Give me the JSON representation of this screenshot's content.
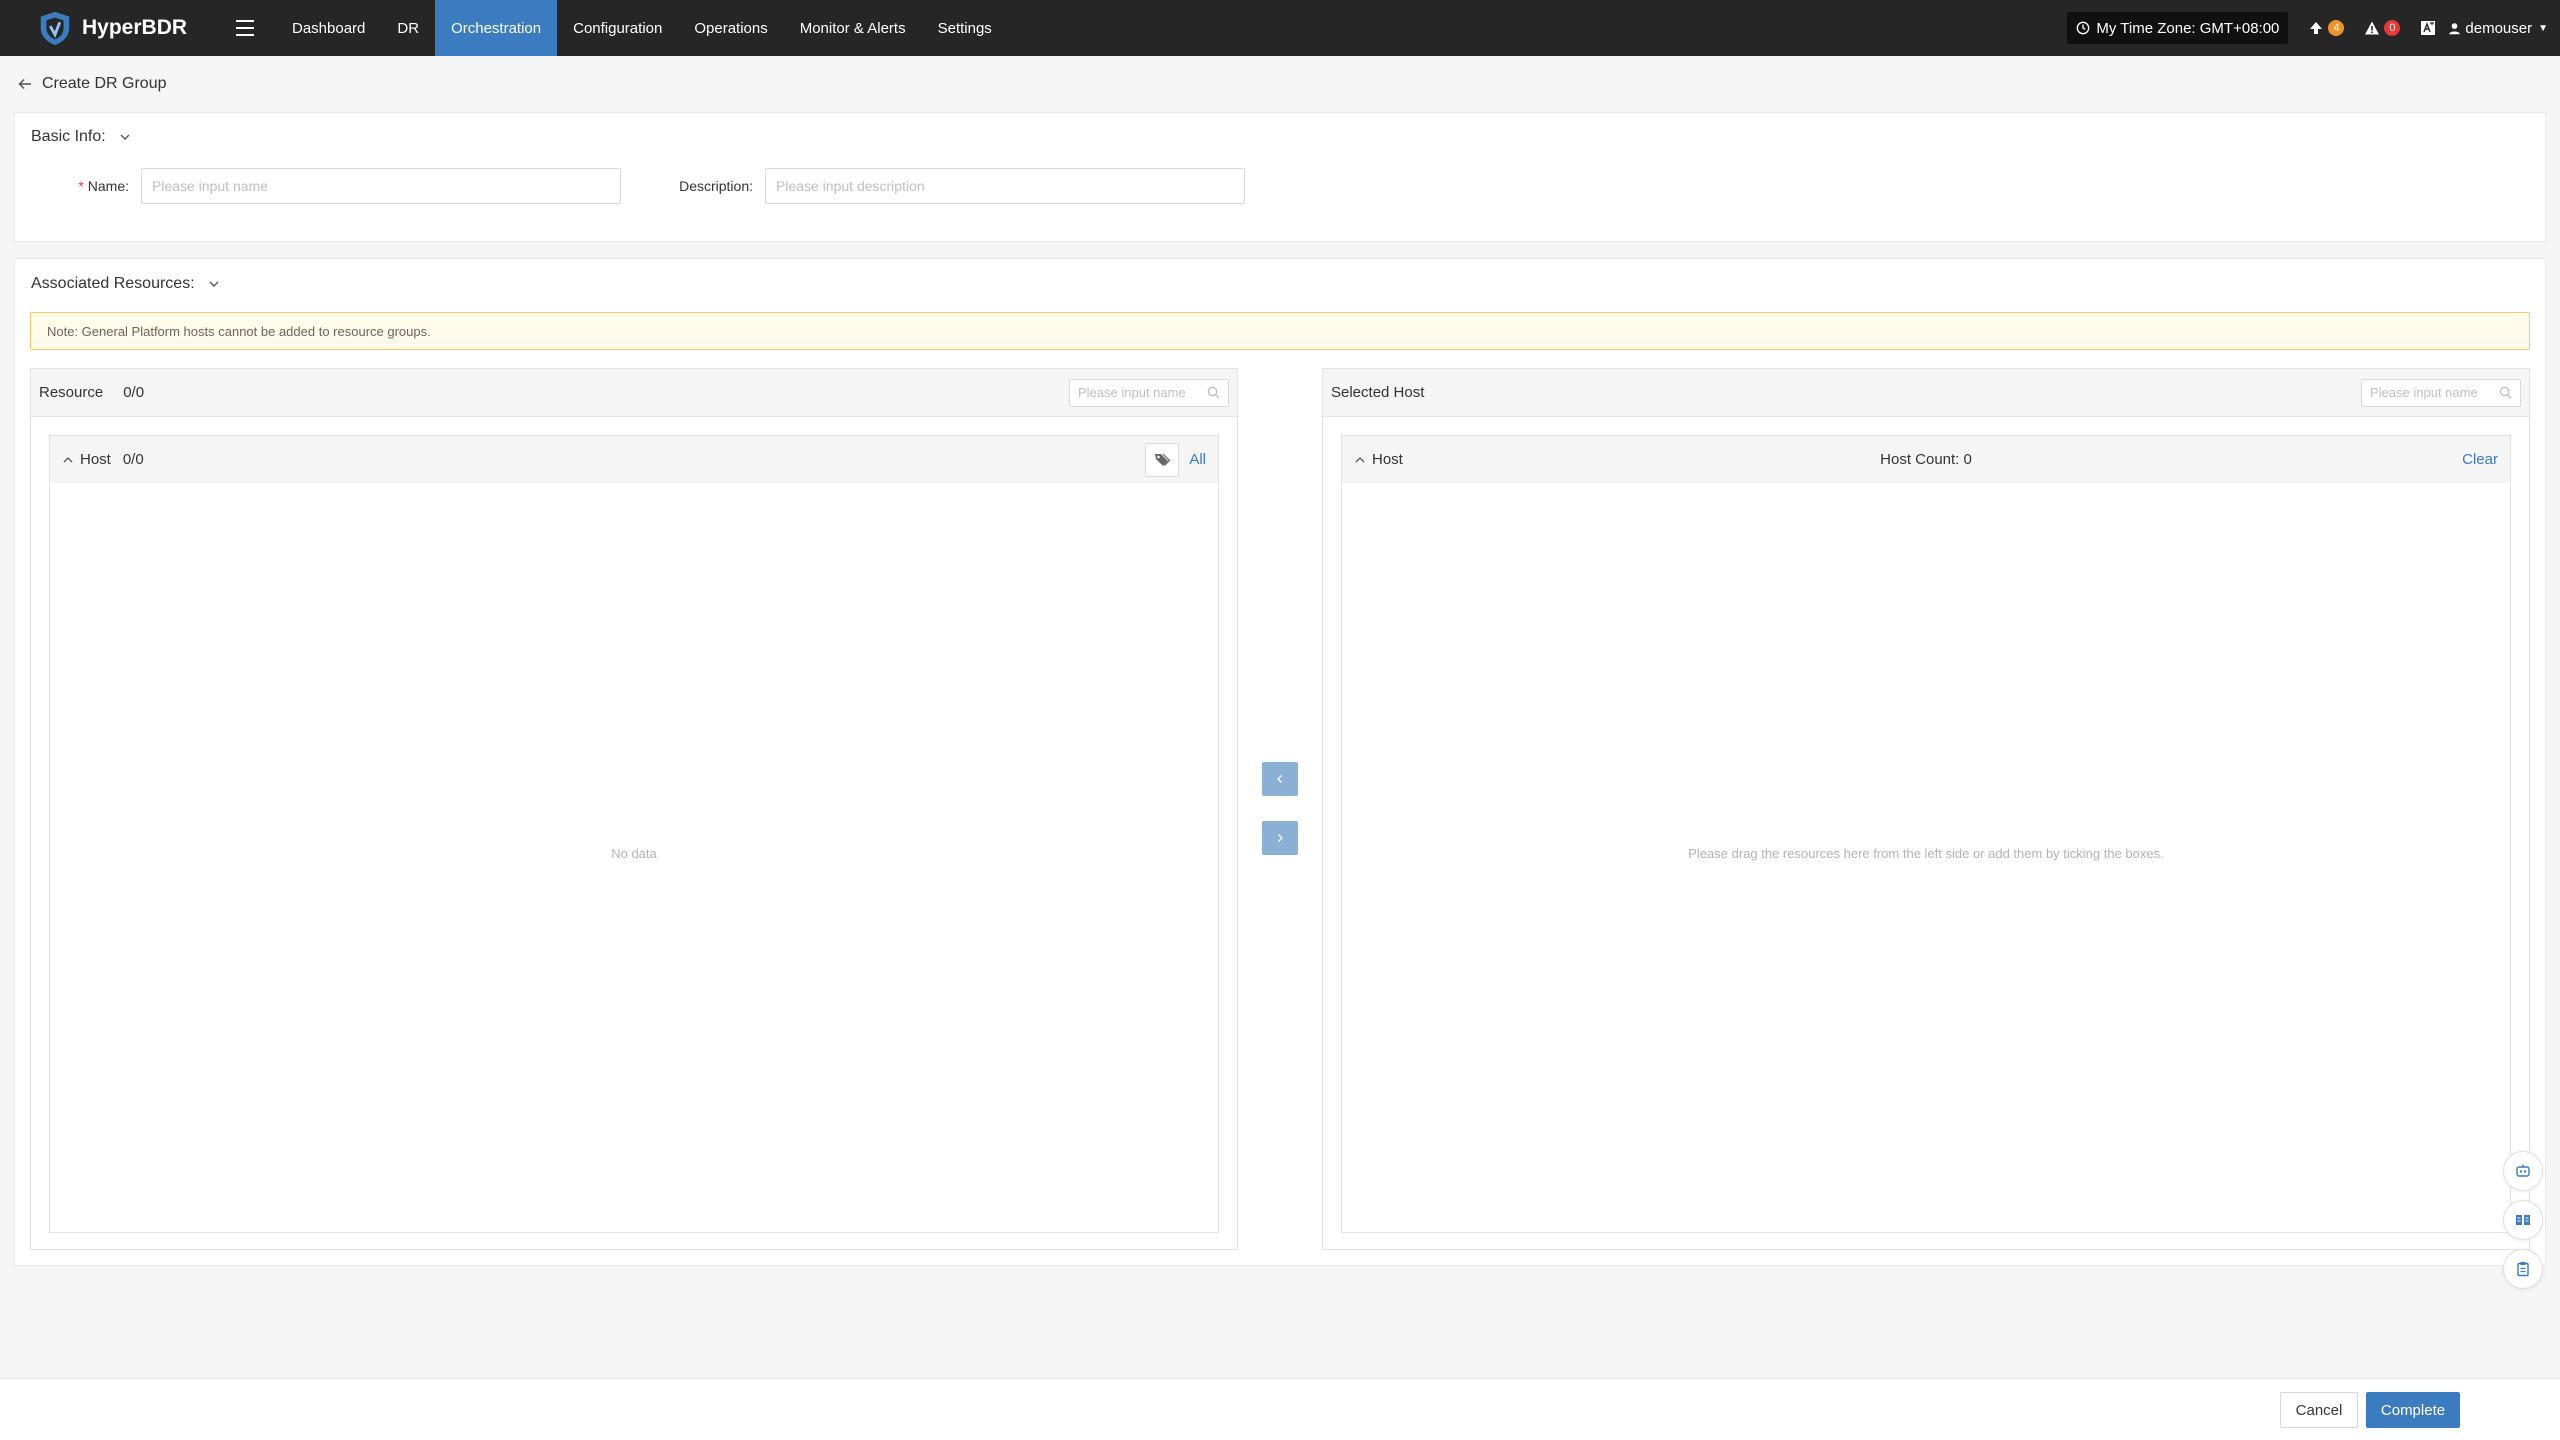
{
  "app": {
    "name": "HyperBDR"
  },
  "nav": {
    "items": [
      {
        "label": "Dashboard"
      },
      {
        "label": "DR"
      },
      {
        "label": "Orchestration"
      },
      {
        "label": "Configuration"
      },
      {
        "label": "Operations"
      },
      {
        "label": "Monitor & Alerts"
      },
      {
        "label": "Settings"
      }
    ],
    "active": "Orchestration"
  },
  "header_right": {
    "timezone": "My Time Zone: GMT+08:00",
    "upgrade_count": "4",
    "alert_count": "0",
    "username": "demouser"
  },
  "page": {
    "title": "Create DR Group"
  },
  "basic_info": {
    "title": "Basic Info:",
    "name_label": "Name:",
    "name_placeholder": "Please input name",
    "description_label": "Description:",
    "description_placeholder": "Please input description"
  },
  "resources": {
    "title": "Associated Resources:",
    "note": "Note: General Platform hosts cannot be added to resource groups.",
    "left": {
      "title": "Resource",
      "count": "0/0",
      "search_placeholder": "Please input name",
      "group_title": "Host",
      "group_count": "0/0",
      "all_label": "All",
      "empty": "No data"
    },
    "right": {
      "title": "Selected Host",
      "search_placeholder": "Please input name",
      "group_title": "Host",
      "host_count": "Host Count: 0",
      "clear_label": "Clear",
      "empty": "Please drag the resources here from the left side or add them by ticking the boxes."
    }
  },
  "footer": {
    "cancel_label": "Cancel",
    "complete_label": "Complete"
  },
  "colors": {
    "accent": "#3b7bbf",
    "topbar": "#262626",
    "warning_border": "#f5c66b",
    "badge_orange": "#f0932b",
    "badge_red": "#e53935"
  }
}
